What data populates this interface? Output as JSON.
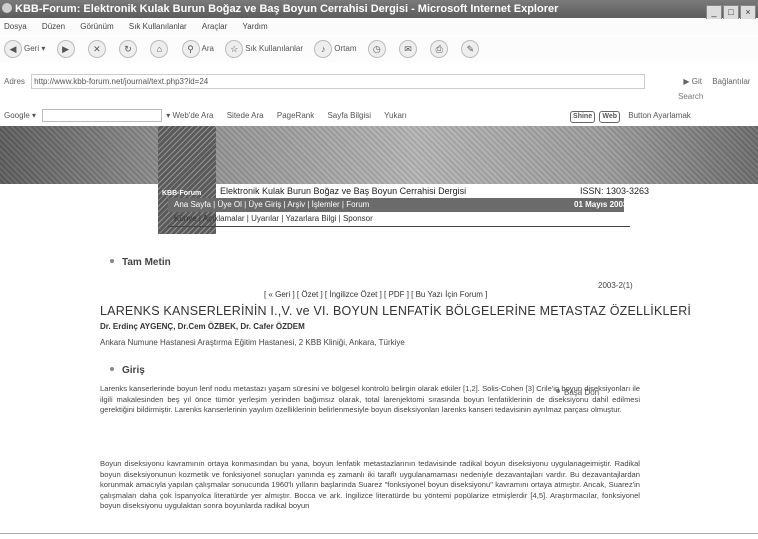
{
  "window": {
    "title": "KBB-Forum: Elektronik Kulak Burun Boğaz ve Baş Boyun Cerrahisi Dergisi - Microsoft Internet Explorer"
  },
  "menu": [
    "Dosya",
    "Düzen",
    "Görünüm",
    "Sık Kullanılanlar",
    "Araçlar",
    "Yardım"
  ],
  "toolbar": {
    "back": "Geri",
    "search": "Ara",
    "favorites": "Sık Kullanılanlar",
    "media": "Ortam"
  },
  "address": {
    "label": "Adres",
    "url": "http://www.kbb-forum.net/journal/text.php3?id=24",
    "go": "Git",
    "links": "Bağlantılar",
    "search_label": "Search"
  },
  "googlebar": {
    "label": "Google",
    "items": [
      "Web'de Ara",
      "Sitede Ara",
      "PageRank",
      "Sayfa Bilgisi",
      "Yukarı"
    ],
    "shine": "Shine",
    "web": "Web",
    "button_text": "Button Ayarlamak"
  },
  "site": {
    "logo_text": "KBB-Forum",
    "journal_title": "Elektronik Kulak Burun Boğaz ve Baş Boyun Cerrahisi Dergisi",
    "issn": "ISSN: 1303-3263",
    "nav": "Ana Sayfa | Üye Ol | Üye Giriş | Arşiv | İşlemler | Forum",
    "date": "01 Mayıs 2003",
    "subnav": "Künye | Açıklamalar | Uyarılar | Yazarlara Bilgi | Sponsor"
  },
  "content": {
    "section_fulltext": "Tam Metin",
    "year_vol": "2003-2(1)",
    "article_nav": "[ « Geri ] [ Özet ] [ İngilizce Özet ] [ PDF ] [ Bu Yazı İçin Forum ]",
    "article_title": "LARENKS KANSERLERİNİN I.,V. ve VI. BOYUN LENFATİK BÖLGELERİNE METASTAZ ÖZELLİKLERİ",
    "authors": "Dr. Erdinç AYGENÇ, Dr.Cem ÖZBEK, Dr. Cafer ÖZDEM",
    "affiliation": "Ankara Numune Hastanesi Araştırma Eğitim Hastanesi, 2 KBB Kliniği, Ankara, Türkiye",
    "section_intro": "Giriş",
    "back_to_top": "Başa Dön",
    "paragraph1": "Larenks kanserlerinde boyun lenf nodu metastazı yaşam süresini ve bölgesel kontrolü belirgin olarak etkiler [1,2]. Solis-Cohen [3] Crile'in boyun diseksiyonları ile ilgili makalesinden beş yıl önce tümör yerleşim yerinden bağımsız olarak, total larenjektomi sırasında boyun lenfatiklerinin de diseksiyonu dahil edilmesi gerektiğini bildirmiştir. Larenks kanserlerinin yayılım özelliklerinin belirlenmesiyle boyun diseksiyonları larenks kanseri tedavisinin ayrılmaz parçası olmuştur.",
    "paragraph2": "Boyun diseksiyonu kavramının ortaya konmasından bu yana, boyun lenfatik metastazlarının tedavisinde radikal boyun diseksiyonu uygulanageimiştir. Radikal boyun diseksiyonunun kozmetik ve fonksiyonel sonuçları yanında eş zamanlı iki taraflı uygulanamaması nedeniyle dezavantajları vardır. Bu dezavantajlardan korunmak amacıyla yapılan çalışmalar sonucunda 1960'lı yılların başlarında Suarez \"fonksiyonel boyun diseksiyonu\" kavramını ortaya atmıştır. Ancak, Suarez'in çalışmaları daha çok İspanyolca literatürde yer almıştır. Bocca ve ark. İngilizce literatürde bu yöntemi popülarize etmişlerdir [4,5]. Araştırmacılar, fonksiyonel boyun diseksiyonu uygulaktan sonra boyunlarda radikal boyun"
  }
}
